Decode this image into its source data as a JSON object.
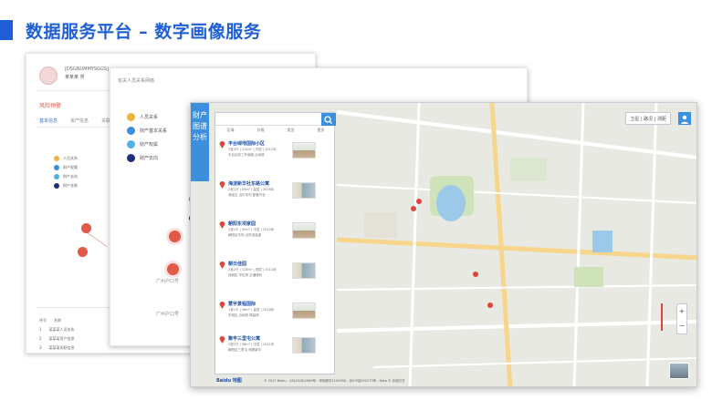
{
  "slide": {
    "title": "数据服务平台 – 数字画像服务",
    "accent": "#1f5fd6"
  },
  "front": {
    "side_tab": "财产图谱分析",
    "search_placeholder": "",
    "filters": [
      "区域",
      "价格",
      "类型",
      "更多"
    ],
    "items": [
      {
        "name": "丰台绿地国际小区",
        "lines": [
          "3室2厅 | 115m² | 中层 | 2012年",
          "丰台区西三环南路 近地铁"
        ]
      },
      {
        "name": "海淀新华社东路公寓",
        "lines": [
          "2室1厅 | 89m² | 高层 | 2008年",
          "海淀区 近中关村 配套齐全"
        ]
      },
      {
        "name": "朝阳东坝家园",
        "lines": [
          "2室1厅 | 92m² | 中层 | 2015年",
          "朝阳区东坝 近机场高速"
        ]
      },
      {
        "name": "朝日佳园",
        "lines": [
          "3室2厅 | 128m² | 低层 | 2010年",
          "西城区 学区房 交通便利"
        ]
      },
      {
        "name": "慧宇景程国际",
        "lines": [
          "1室1厅 | 56m² | 高层 | 2018年",
          "东城区 近地铁 精装修"
        ]
      },
      {
        "name": "聚丰三里屯公寓",
        "lines": [
          "2室2厅 | 98m² | 中层 | 2011年",
          "朝阳区三里屯 商圈繁华"
        ]
      }
    ],
    "map_controls": "卫星 | 路况 | 测距",
    "zoom_plus": "+",
    "zoom_minus": "−",
    "logo": "Baidu 地图",
    "copyright": "© 2017 Baidu - GS(2016)2089号 - 甲测资字1100930 - 京ICP证030173号 - Data © 长地万方"
  },
  "middle": {
    "title": "有关人员关系网络",
    "legend": [
      {
        "label": "人员关系",
        "color": "#f0b23a"
      },
      {
        "label": "财产基本关系",
        "color": "#3b8fdc"
      },
      {
        "label": "财产权属",
        "color": "#4fb3e8"
      },
      {
        "label": "财产去向",
        "color": "#1d2f7a"
      }
    ],
    "node_caption_1": "广州户口号",
    "node_caption_2": "广州户口号"
  },
  "back": {
    "header_line1": "[DSGNUMMYSGGS]",
    "header_line2": "某某某 男",
    "section_title": "风险预警",
    "tabs": [
      "基本信息",
      "资产信息",
      "关联信息",
      "事件信息"
    ],
    "legend": [
      "人员关系",
      "财产权属",
      "财产去向",
      "财产关联"
    ],
    "table_rows": [
      [
        "序号",
        "名称"
      ],
      [
        "1",
        "某某某人员关系"
      ],
      [
        "2",
        "某某某资产信息"
      ],
      [
        "3",
        "某某某关联信息"
      ]
    ]
  }
}
